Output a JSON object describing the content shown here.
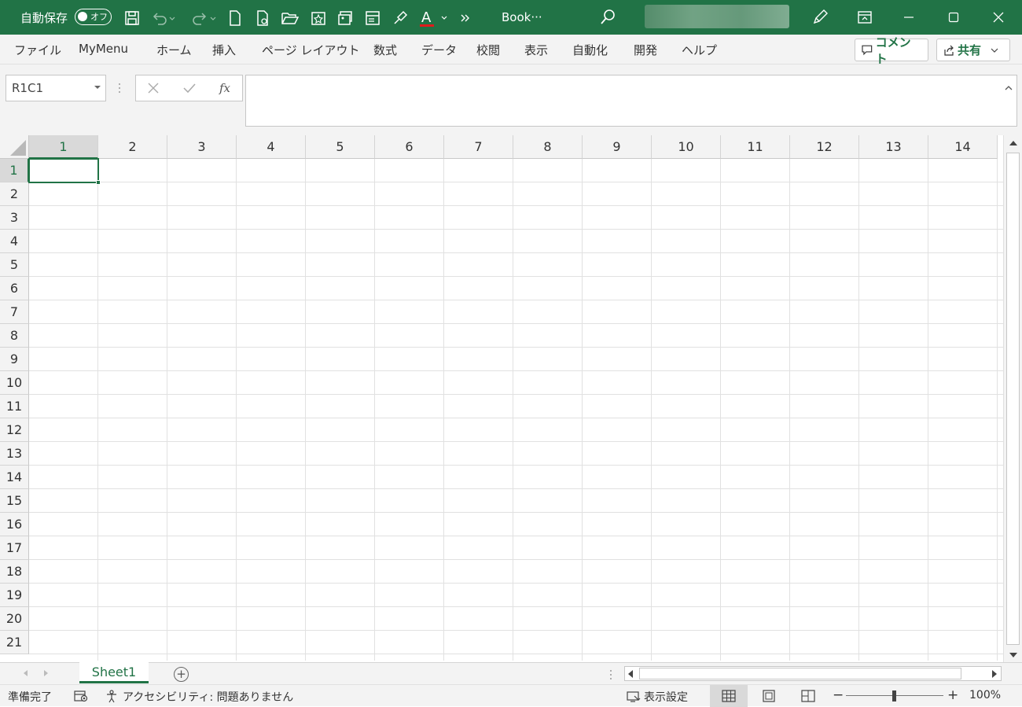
{
  "titlebar": {
    "autosave_label": "自動保存",
    "autosave_state": "オフ",
    "doc_title": "Book···",
    "quick_access_icons": [
      "save-icon",
      "undo-icon",
      "redo-icon",
      "new-doc-icon",
      "print-preview-icon",
      "open-folder-icon",
      "favorite-icon",
      "insert-picture-icon",
      "form-icon",
      "format-painter-icon",
      "font-color-icon",
      "more-commands-icon"
    ],
    "font_color_accent": "#e01b1b"
  },
  "ribbon": {
    "tabs": [
      "ファイル",
      "MyMenu",
      "ホーム",
      "挿入",
      "ページ レイアウト",
      "数式",
      "データ",
      "校閲",
      "表示",
      "自動化",
      "開発",
      "ヘルプ"
    ],
    "comment_label": "コメント",
    "share_label": "共有"
  },
  "formula_bar": {
    "name_box": "R1C1",
    "formula": ""
  },
  "grid": {
    "columns": [
      "1",
      "2",
      "3",
      "4",
      "5",
      "6",
      "7",
      "8",
      "9",
      "10",
      "11",
      "12",
      "13",
      "14"
    ],
    "rows": [
      "1",
      "2",
      "3",
      "4",
      "5",
      "6",
      "7",
      "8",
      "9",
      "10",
      "11",
      "12",
      "13",
      "14",
      "15",
      "16",
      "17",
      "18",
      "19",
      "20",
      "21"
    ],
    "active_cell": "R1C1"
  },
  "sheets": {
    "tabs": [
      "Sheet1"
    ]
  },
  "statusbar": {
    "ready": "準備完了",
    "accessibility": "アクセシビリティ: 問題ありません",
    "display_settings": "表示設定",
    "zoom": "100%"
  },
  "colors": {
    "brand": "#217346",
    "chrome": "#f3f3f3"
  }
}
